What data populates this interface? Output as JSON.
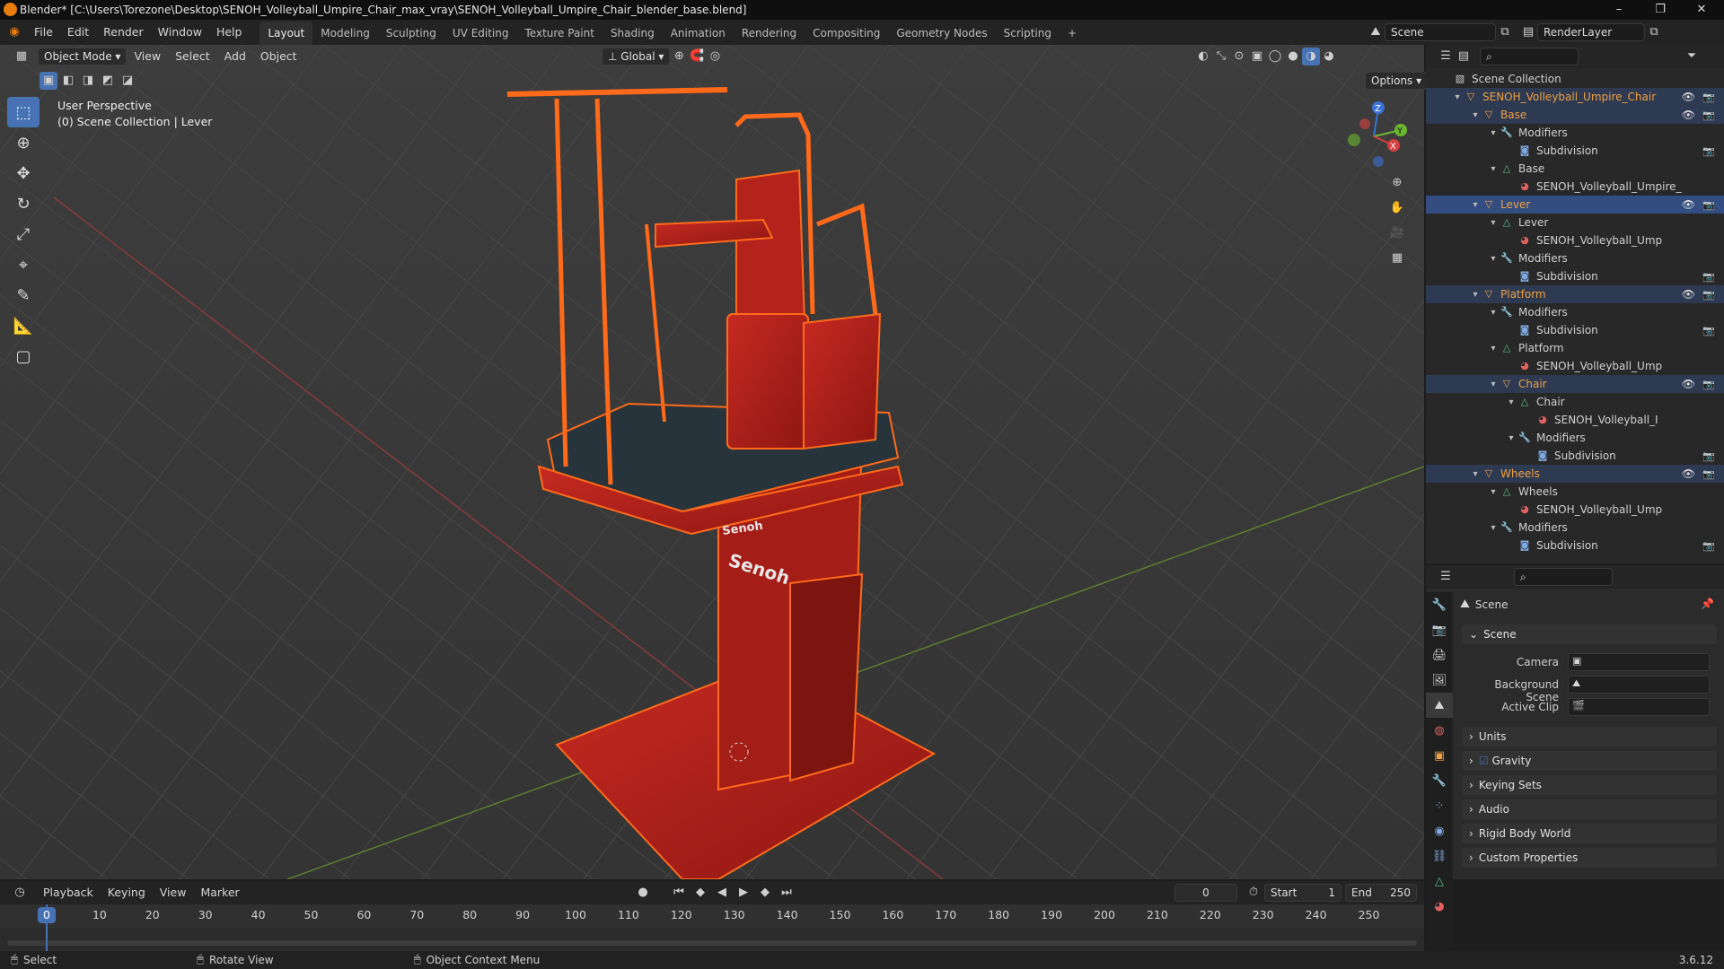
{
  "window": {
    "title": "Blender* [C:\\Users\\Torezone\\Desktop\\SENOH_Volleyball_Umpire_Chair_max_vray\\SENOH_Volleyball_Umpire_Chair_blender_base.blend]",
    "controls": [
      "–",
      "❐",
      "✕"
    ]
  },
  "menu": [
    "File",
    "Edit",
    "Render",
    "Window",
    "Help"
  ],
  "workspaces": [
    "Layout",
    "Modeling",
    "Sculpting",
    "UV Editing",
    "Texture Paint",
    "Shading",
    "Animation",
    "Rendering",
    "Compositing",
    "Geometry Nodes",
    "Scripting",
    "+"
  ],
  "active_workspace": "Layout",
  "scene_field": "Scene",
  "layer_field": "RenderLayer",
  "viewport": {
    "mode": "Object Mode",
    "menus": [
      "View",
      "Select",
      "Add",
      "Object"
    ],
    "transform": "Global",
    "options": "Options",
    "info_line1": "User Perspective",
    "info_line2": "(0) Scene Collection | Lever",
    "gizmo_axes": [
      "Z",
      "Y",
      "X"
    ],
    "logo1": "Senoh",
    "logo2": "Senoh"
  },
  "outliner": {
    "root": "Scene Collection",
    "rows": [
      {
        "label": "SENOH_Volleyball_Umpire_Chair",
        "indent": 0,
        "type": "object",
        "eye": true,
        "cam": true,
        "style": "hl"
      },
      {
        "label": "Base",
        "indent": 1,
        "type": "object",
        "eye": true,
        "cam": true,
        "style": "hl"
      },
      {
        "label": "Modifiers",
        "indent": 2,
        "type": "modifiers",
        "eye": false,
        "cam": false,
        "style": ""
      },
      {
        "label": "Subdivision",
        "indent": 3,
        "type": "subdiv",
        "eye": false,
        "cam": true,
        "style": ""
      },
      {
        "label": "Base",
        "indent": 2,
        "type": "mesh",
        "eye": false,
        "cam": false,
        "style": ""
      },
      {
        "label": "SENOH_Volleyball_Umpire_",
        "indent": 3,
        "type": "material",
        "eye": false,
        "cam": false,
        "style": ""
      },
      {
        "label": "Lever",
        "indent": 1,
        "type": "object",
        "eye": true,
        "cam": true,
        "style": "sel"
      },
      {
        "label": "Lever",
        "indent": 2,
        "type": "mesh",
        "eye": false,
        "cam": false,
        "style": ""
      },
      {
        "label": "SENOH_Volleyball_Ump",
        "indent": 3,
        "type": "material",
        "eye": false,
        "cam": false,
        "style": ""
      },
      {
        "label": "Modifiers",
        "indent": 2,
        "type": "modifiers",
        "eye": false,
        "cam": false,
        "style": ""
      },
      {
        "label": "Subdivision",
        "indent": 3,
        "type": "subdiv",
        "eye": false,
        "cam": true,
        "style": ""
      },
      {
        "label": "Platform",
        "indent": 1,
        "type": "object",
        "eye": true,
        "cam": true,
        "style": "hl"
      },
      {
        "label": "Modifiers",
        "indent": 2,
        "type": "modifiers",
        "eye": false,
        "cam": false,
        "style": ""
      },
      {
        "label": "Subdivision",
        "indent": 3,
        "type": "subdiv",
        "eye": false,
        "cam": true,
        "style": ""
      },
      {
        "label": "Platform",
        "indent": 2,
        "type": "mesh",
        "eye": false,
        "cam": false,
        "style": ""
      },
      {
        "label": "SENOH_Volleyball_Ump",
        "indent": 3,
        "type": "material",
        "eye": false,
        "cam": false,
        "style": ""
      },
      {
        "label": "Chair",
        "indent": 2,
        "type": "object",
        "eye": true,
        "cam": true,
        "style": "hl"
      },
      {
        "label": "Chair",
        "indent": 3,
        "type": "mesh",
        "eye": false,
        "cam": false,
        "style": ""
      },
      {
        "label": "SENOH_Volleyball_I",
        "indent": 4,
        "type": "material",
        "eye": false,
        "cam": false,
        "style": ""
      },
      {
        "label": "Modifiers",
        "indent": 3,
        "type": "modifiers",
        "eye": false,
        "cam": false,
        "style": ""
      },
      {
        "label": "Subdivision",
        "indent": 4,
        "type": "subdiv",
        "eye": false,
        "cam": true,
        "style": ""
      },
      {
        "label": "Wheels",
        "indent": 1,
        "type": "object",
        "eye": true,
        "cam": true,
        "style": "hl"
      },
      {
        "label": "Wheels",
        "indent": 2,
        "type": "mesh",
        "eye": false,
        "cam": false,
        "style": ""
      },
      {
        "label": "SENOH_Volleyball_Ump",
        "indent": 3,
        "type": "material",
        "eye": false,
        "cam": false,
        "style": ""
      },
      {
        "label": "Modifiers",
        "indent": 2,
        "type": "modifiers",
        "eye": false,
        "cam": false,
        "style": ""
      },
      {
        "label": "Subdivision",
        "indent": 3,
        "type": "subdiv",
        "eye": false,
        "cam": true,
        "style": ""
      }
    ]
  },
  "properties": {
    "header": "Scene",
    "section": "Scene",
    "camera_label": "Camera",
    "bg_label": "Background Scene",
    "clip_label": "Active Clip",
    "panels": [
      "Units",
      "Gravity",
      "Keying Sets",
      "Audio",
      "Rigid Body World",
      "Custom Properties"
    ],
    "gravity_checked": true
  },
  "timeline": {
    "menus": [
      "Playback",
      "Keying",
      "View",
      "Marker"
    ],
    "current_frame": "0",
    "start_label": "Start",
    "start": "1",
    "end_label": "End",
    "end": "250",
    "ticks": [
      "0",
      "10",
      "20",
      "30",
      "40",
      "50",
      "60",
      "70",
      "80",
      "90",
      "100",
      "110",
      "120",
      "130",
      "140",
      "150",
      "160",
      "170",
      "180",
      "190",
      "200",
      "210",
      "220",
      "230",
      "240",
      "250"
    ]
  },
  "status": {
    "select": "Select",
    "rotate": "Rotate View",
    "context": "Object Context Menu",
    "version": "3.6.12"
  },
  "colors": {
    "selection": "#ff6a1a",
    "object": "#b31f1b",
    "accent": "#4772b3"
  }
}
